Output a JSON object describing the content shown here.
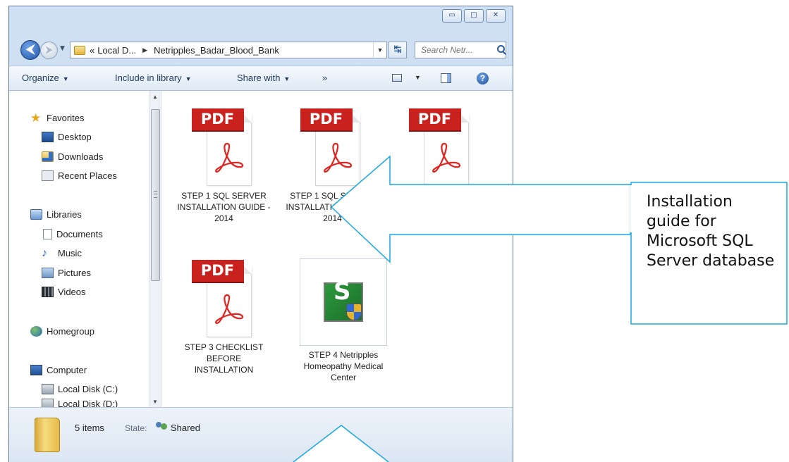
{
  "window": {
    "controls": {
      "minimize": "▭",
      "maximize": "□",
      "close": "✕"
    }
  },
  "address": {
    "crumb_overflow": "«",
    "crumbs": [
      "Local D...",
      "Netripples_Badar_Blood_Bank"
    ],
    "search_placeholder": "Search Netr..."
  },
  "toolbar": {
    "organize": "Organize",
    "include_in_library": "Include in library",
    "share_with": "Share with",
    "more": "»"
  },
  "nav": {
    "favorites": "Favorites",
    "desktop": "Desktop",
    "downloads": "Downloads",
    "recent_places": "Recent Places",
    "libraries": "Libraries",
    "documents": "Documents",
    "music": "Music",
    "pictures": "Pictures",
    "videos": "Videos",
    "homegroup": "Homegroup",
    "computer": "Computer",
    "local_disk_c": "Local Disk (C:)",
    "local_disk_d": "Local Disk (D:)"
  },
  "files": [
    {
      "name": "STEP 1 SQL SERVER INSTALLATION GUIDE - 2014",
      "badge": "PDF"
    },
    {
      "name": "STEP 1 SQL SERVER INSTALLATION GUIDE - 2014",
      "badge": "PDF"
    },
    {
      "name": "",
      "badge": "PDF"
    },
    {
      "name": "STEP 3 CHECKLIST BEFORE INSTALLATION",
      "badge": "PDF"
    },
    {
      "name": "STEP 4 Netripples Homeopathy Medical Center",
      "badge": ""
    }
  ],
  "details": {
    "count": "5 items",
    "state_label": "State:",
    "state_value": "Shared"
  },
  "callout": {
    "text": "Installation guide for Microsoft SQL Server database"
  },
  "colors": {
    "callout_border": "#1aa7e6",
    "pdf_red": "#c9211e",
    "acrobat_red": "#e0241f"
  }
}
